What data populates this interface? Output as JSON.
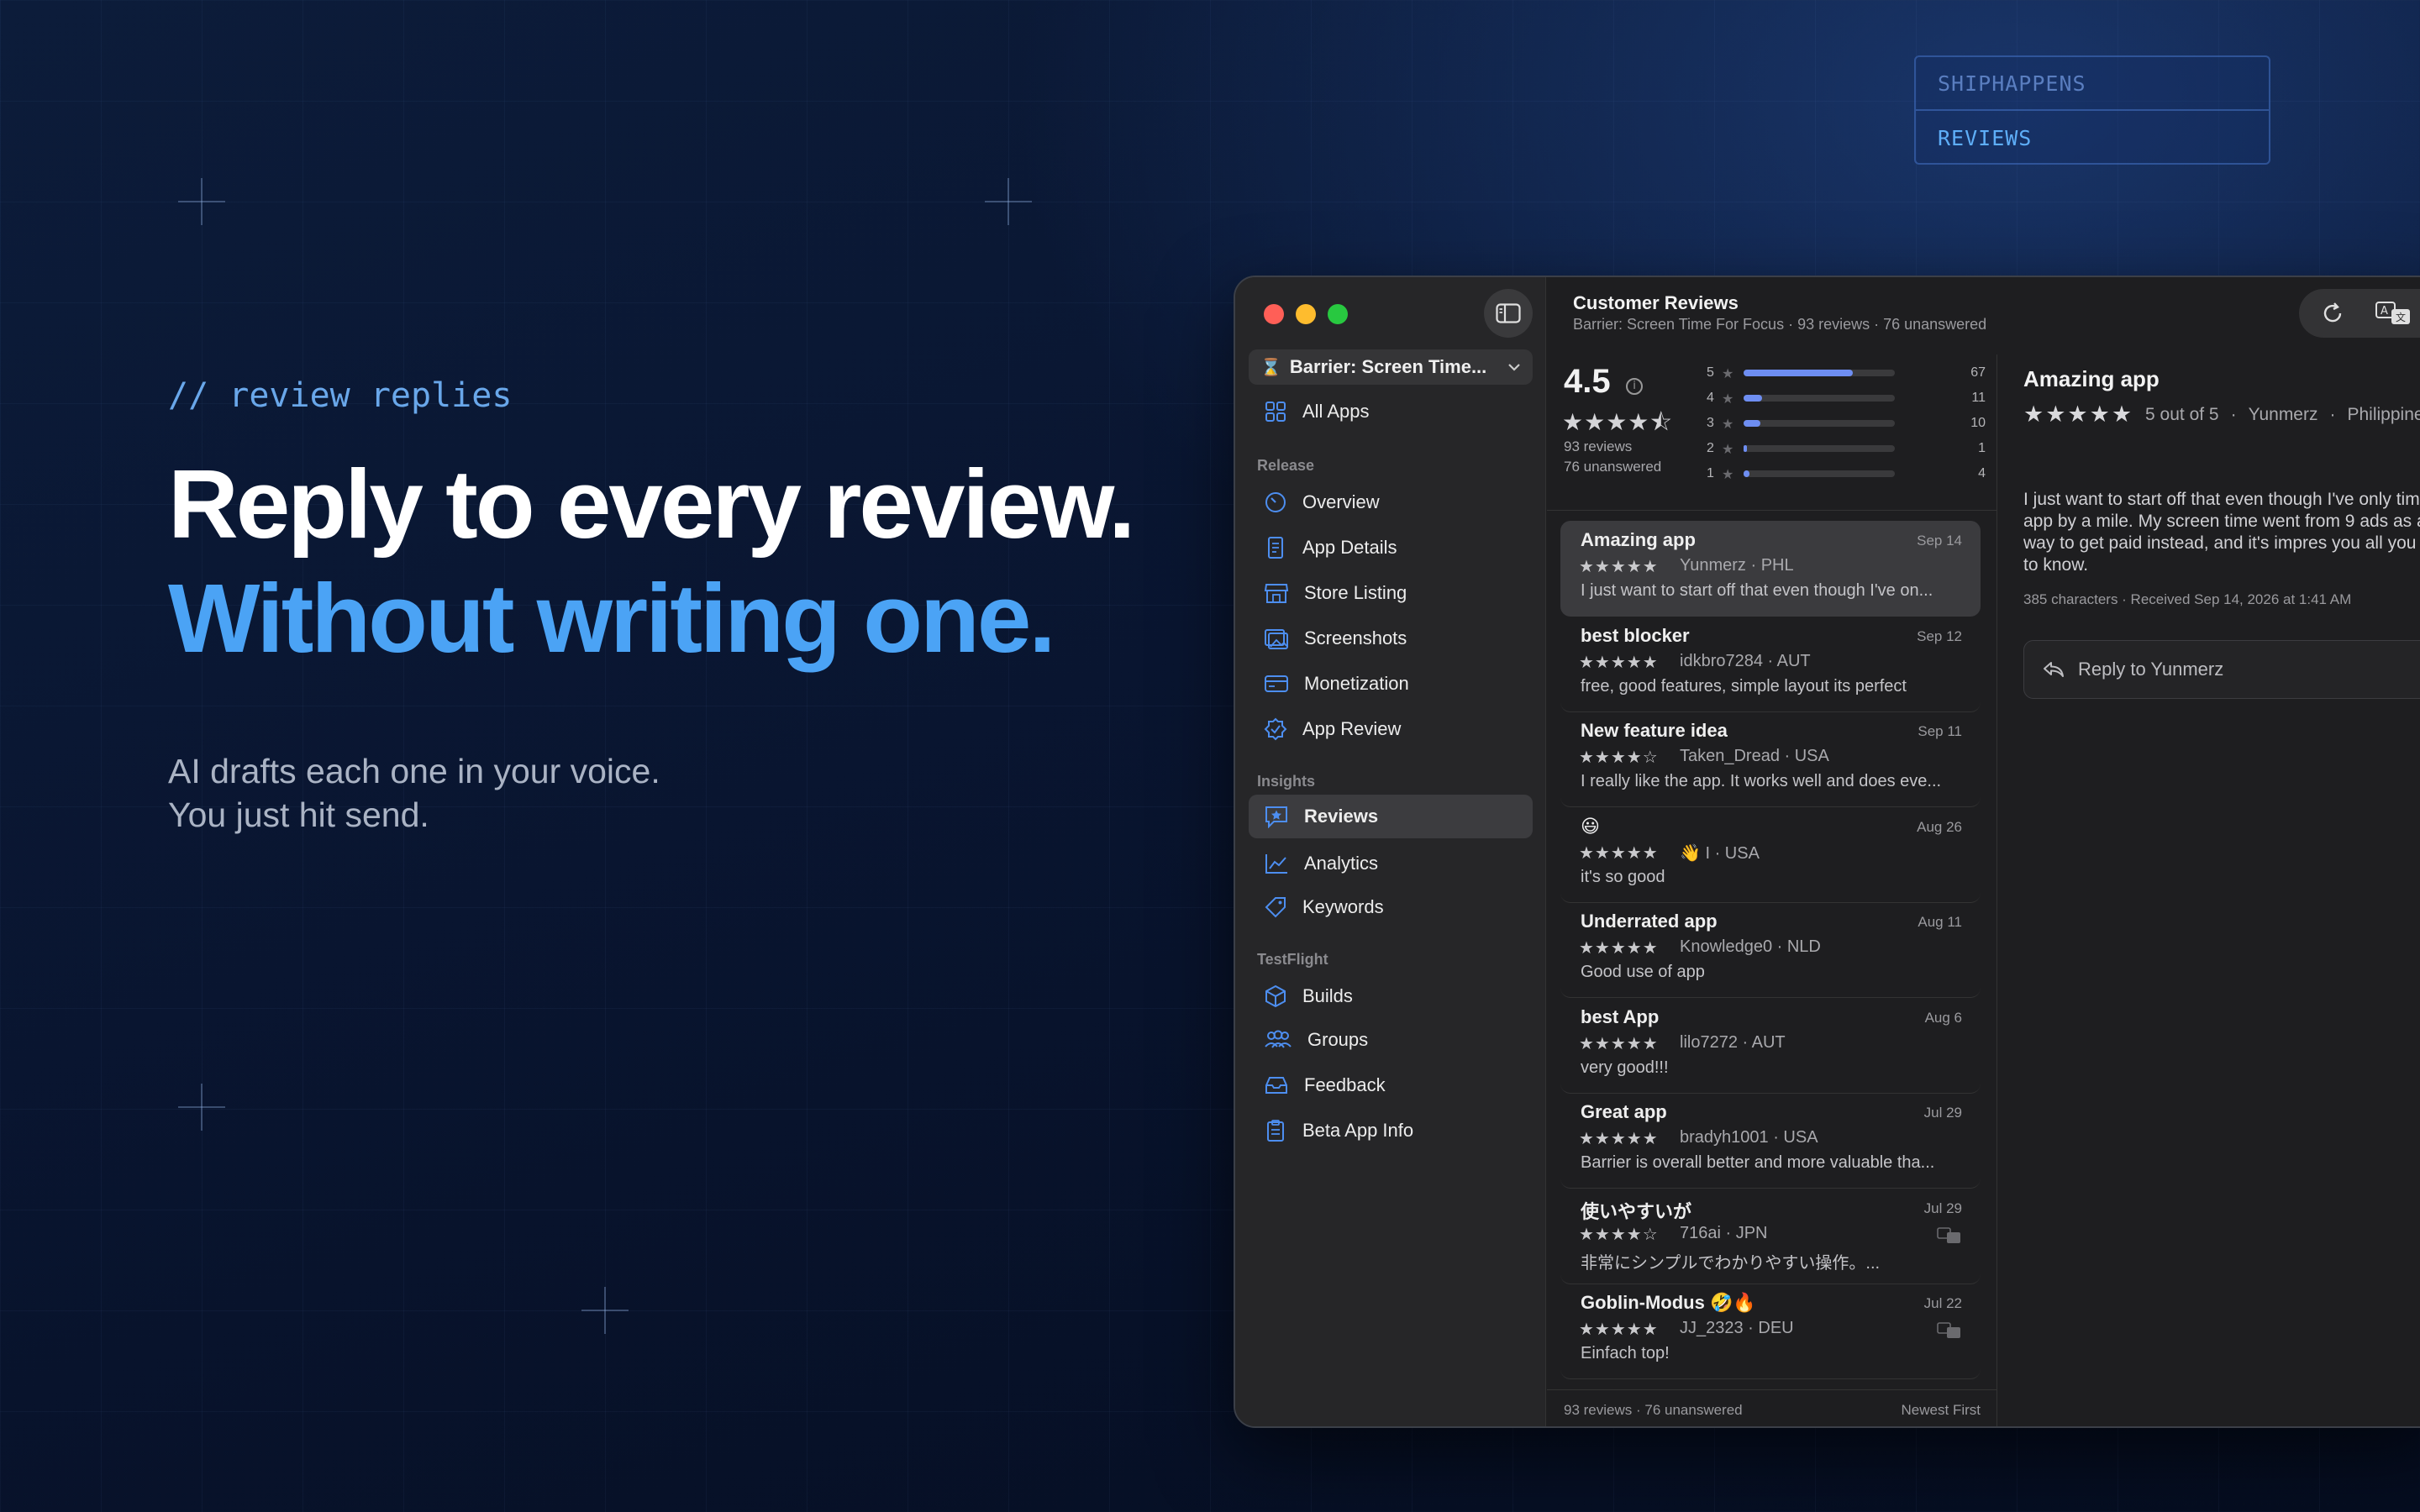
{
  "badge": {
    "top": "SHIPHAPPENS",
    "bottom": "REVIEWS"
  },
  "hero": {
    "tag": "// review replies",
    "headline1": "Reply to every review.",
    "headline2": "Without writing one.",
    "sub1": "AI drafts each one in your voice.",
    "sub2": "You just hit send."
  },
  "window": {
    "title": "Customer Reviews",
    "subtitle": "Barrier: Screen Time For Focus · 93 reviews · 76 unanswered"
  },
  "sidebar": {
    "app_selector": "Barrier: Screen Time...",
    "all_apps": "All Apps",
    "sections": {
      "release": "Release",
      "insights": "Insights",
      "testflight": "TestFlight"
    },
    "items": {
      "overview": "Overview",
      "app_details": "App Details",
      "store_listing": "Store Listing",
      "screenshots": "Screenshots",
      "monetization": "Monetization",
      "app_review": "App Review",
      "reviews": "Reviews",
      "analytics": "Analytics",
      "keywords": "Keywords",
      "builds": "Builds",
      "groups": "Groups",
      "feedback": "Feedback",
      "beta_app_info": "Beta App Info"
    },
    "icons": [
      "grid-icon",
      "gauge-icon",
      "document-icon",
      "storefront-icon",
      "photos-icon",
      "creditcard-icon",
      "checkmark-seal-icon",
      "star-bubble-icon",
      "chart-icon",
      "tag-icon",
      "cube-icon",
      "people-icon",
      "tray-icon",
      "clipboard-icon"
    ]
  },
  "summary": {
    "rating": "4.5",
    "stars": "★★★★⯪",
    "reviews": "93 reviews",
    "unanswered": "76 unanswered",
    "distribution": [
      {
        "star": "5",
        "count": "67",
        "fraction": 0.72
      },
      {
        "star": "4",
        "count": "11",
        "fraction": 0.12
      },
      {
        "star": "3",
        "count": "10",
        "fraction": 0.11
      },
      {
        "star": "2",
        "count": "1",
        "fraction": 0.02
      },
      {
        "star": "1",
        "count": "4",
        "fraction": 0.04
      }
    ]
  },
  "reviews": [
    {
      "title": "Amazing app",
      "date": "Sep 14",
      "stars": "★★★★★",
      "author": "Yunmerz · PHL",
      "body": "I just want to start off that even though I've on..."
    },
    {
      "title": "best blocker",
      "date": "Sep 12",
      "stars": "★★★★★",
      "author": "idkbro7284 · AUT",
      "body": "free, good features, simple layout its perfect"
    },
    {
      "title": "New feature idea",
      "date": "Sep 11",
      "stars": "★★★★☆",
      "author": "Taken_Dread · USA",
      "body": "I really like the app. It works well and does eve..."
    },
    {
      "title": "😃",
      "date": "Aug 26",
      "stars": "★★★★★",
      "author": "👋 I · USA",
      "body": "it's so good"
    },
    {
      "title": "Underrated app",
      "date": "Aug 11",
      "stars": "★★★★★",
      "author": "Knowledge0 · NLD",
      "body": "Good use of app"
    },
    {
      "title": "best App",
      "date": "Aug 6",
      "stars": "★★★★★",
      "author": "lilo7272 · AUT",
      "body": "very good!!!"
    },
    {
      "title": "Great app",
      "date": "Jul 29",
      "stars": "★★★★★",
      "author": "bradyh1001 · USA",
      "body": "Barrier is overall better and more valuable tha..."
    },
    {
      "title": "使いやすいが",
      "date": "Jul 29",
      "stars": "★★★★☆",
      "author": "716ai · JPN",
      "body": "非常にシンプルでわかりやすい操作。..."
    },
    {
      "title": "Goblin-Modus 🤣🔥",
      "date": "Jul 22",
      "stars": "★★★★★",
      "author": "JJ_2323 · DEU",
      "body": "Einfach top!"
    }
  ],
  "list_footer": {
    "count": "93 reviews · 76 unanswered",
    "sort": "Newest First"
  },
  "detail": {
    "title": "Amazing app",
    "stars": "★★★★★",
    "rating_text": "5 out of 5",
    "author": "Yunmerz",
    "country": "Philippines",
    "body": "I just want to start off that even though I've only time app by a mile. My screen time went from 9 ads as a way to get paid instead, and  it's impres you all you need to know.",
    "info": "385 characters · Received Sep 14, 2026 at 1:41 AM",
    "reply_label": "Reply to Yunmerz"
  },
  "colors": {
    "accent": "#4ba3f5",
    "bar": "#6e8ef2",
    "selected_nav": "#3c3c3f"
  }
}
